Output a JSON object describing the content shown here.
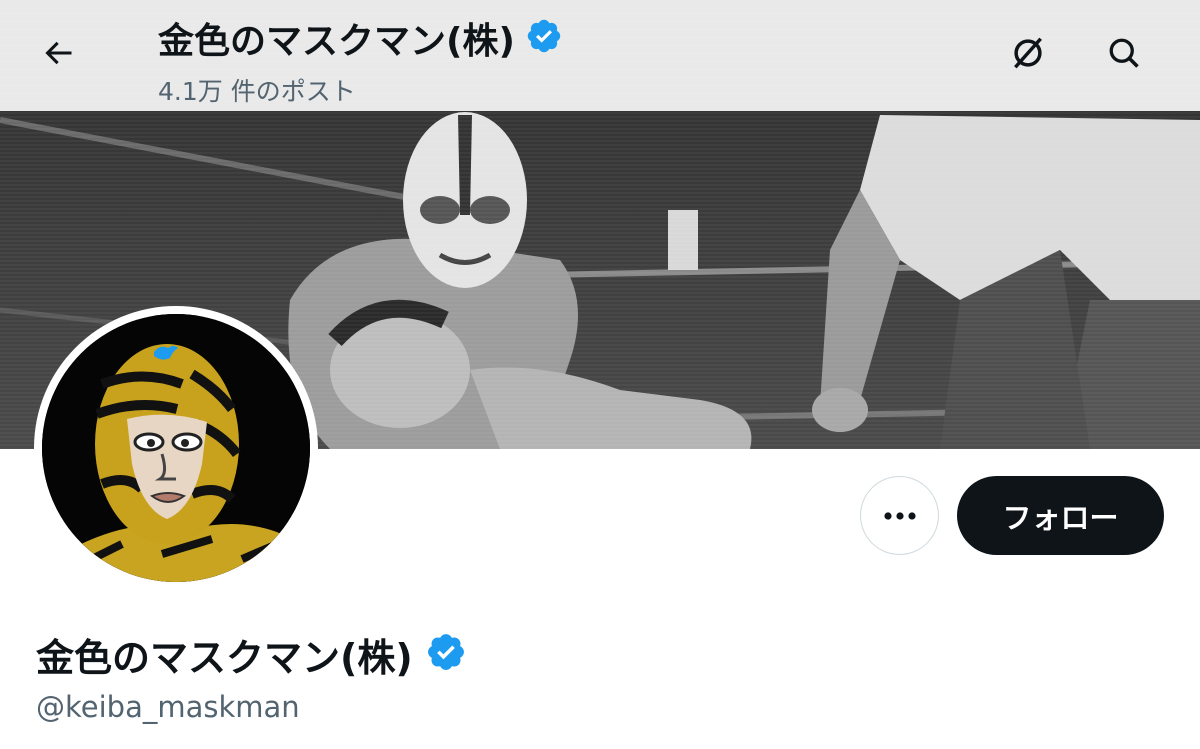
{
  "header": {
    "title": "金色のマスクマン(株)",
    "post_count": "4.1万 件のポスト",
    "back_icon": "arrow-left-icon",
    "grok_icon": "grok-icon",
    "search_icon": "search-icon"
  },
  "profile": {
    "display_name": "金色のマスクマン(株)",
    "handle": "@keiba_maskman",
    "verified_icon": "verified-badge-icon"
  },
  "actions": {
    "more_icon": "more-dots-icon",
    "follow_label": "フォロー"
  },
  "colors": {
    "verified": "#1d9bf0",
    "follow_bg": "#0f1419",
    "secondary_text": "#536471",
    "border": "#cfd9de"
  }
}
